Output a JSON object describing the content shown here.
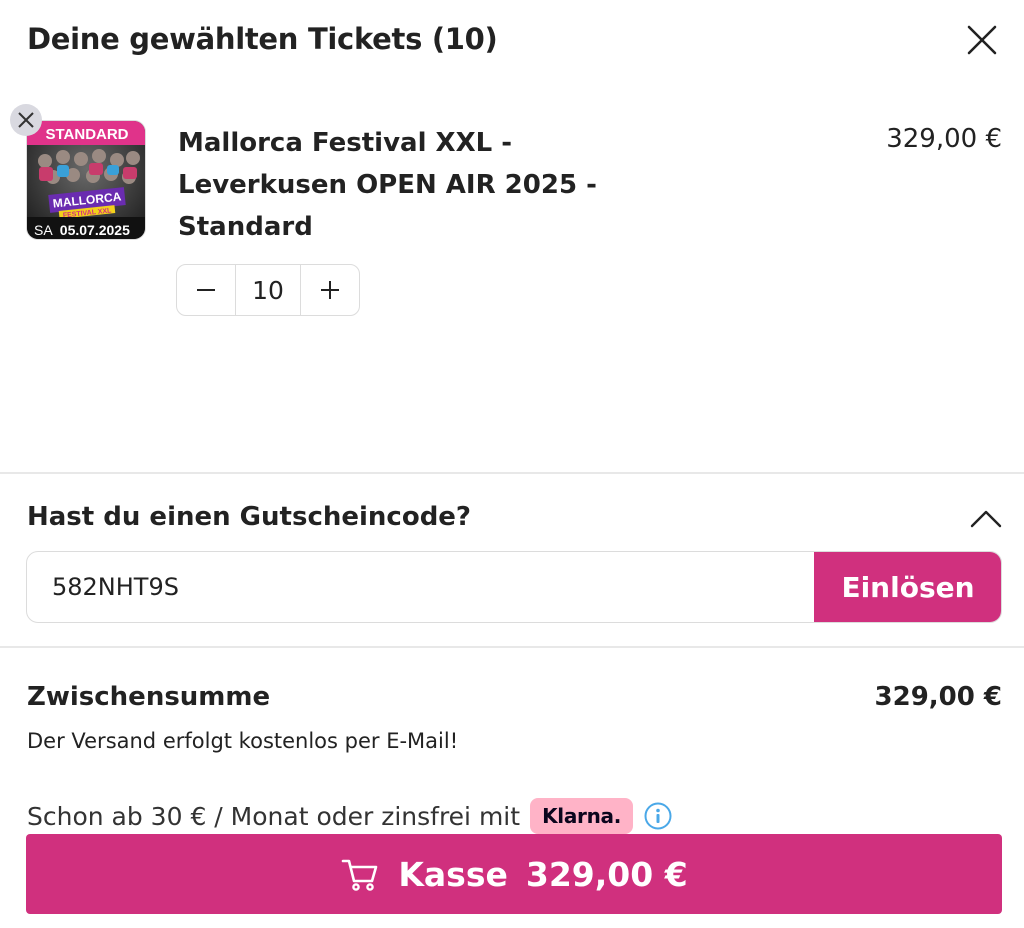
{
  "header": {
    "title": "Deine gewählten Tickets (10)"
  },
  "item": {
    "title": "Mallorca Festival XXL - Leverkusen OPEN AIR 2025 - Standard",
    "price": "329,00 €",
    "quantity": "10",
    "thumbnail": {
      "tag": "STANDARD",
      "logo_top": "MALLORCA",
      "logo_bottom": "FESTIVAL XXL",
      "date_day": "SA",
      "date": "05.07.2025"
    }
  },
  "voucher": {
    "title": "Hast du einen Gutscheincode?",
    "code": "582NHT9S",
    "redeem_label": "Einlösen"
  },
  "summary": {
    "subtotal_label": "Zwischensumme",
    "subtotal_value": "329,00 €",
    "shipping_note": "Der Versand erfolgt kostenlos per E-Mail!",
    "installment_text": "Schon ab 30 € / Monat oder zinsfrei mit",
    "klarna_label": "Klarna."
  },
  "checkout": {
    "label": "Kasse",
    "amount": "329,00 €"
  },
  "colors": {
    "accent": "#d0307e",
    "klarna": "#ffb3c7",
    "info": "#4aa8e8"
  },
  "icons": [
    "close-icon",
    "remove-icon",
    "minus-icon",
    "plus-icon",
    "chevron-up-icon",
    "info-icon",
    "cart-icon"
  ]
}
